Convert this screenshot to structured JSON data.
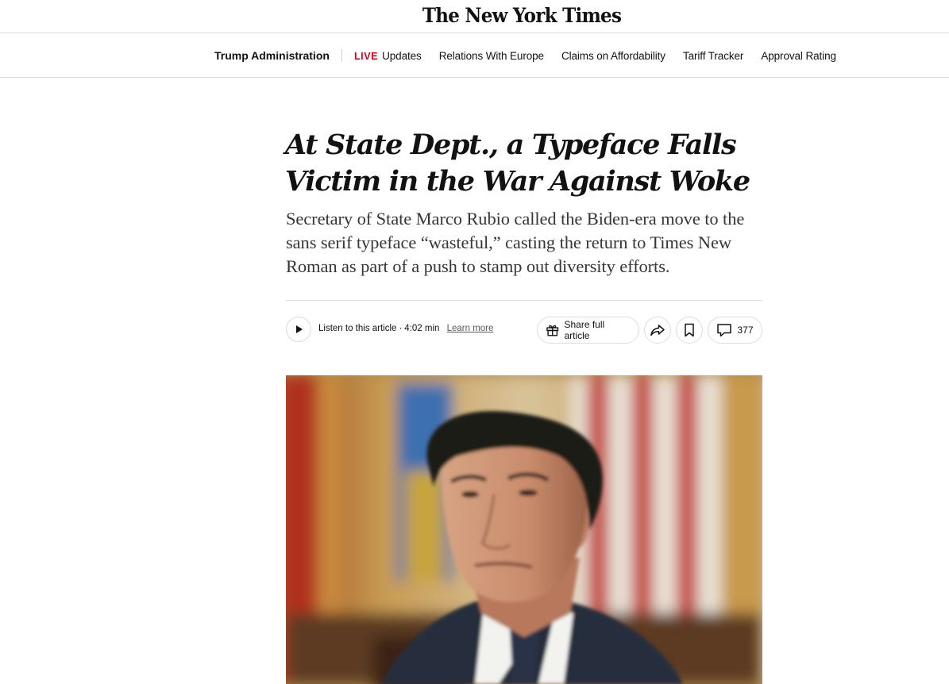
{
  "masthead": {
    "logo_text": "The New York Times"
  },
  "subnav": {
    "section_title": "Trump Administration",
    "live_tag": "LIVE",
    "links": [
      "Updates",
      "Relations With Europe",
      "Claims on Affordability",
      "Tariff Tracker",
      "Approval Rating"
    ],
    "live_color": "#d0021b"
  },
  "article": {
    "headline": "At State Dept., a Typeface Falls Victim in the War Against Woke",
    "summary": "Secretary of State Marco Rubio called the Biden-era move to the sans serif typeface “wasteful,” casting the return to Times New Roman as part of a push to stamp out diversity efforts."
  },
  "tools": {
    "listen_label": "Listen to this article",
    "separator": "·",
    "duration": "4:02 min",
    "learn_more": "Learn more",
    "share_full": "Share full article",
    "comment_count": "377",
    "icons": [
      "play-icon",
      "gift-icon",
      "share-arrow-icon",
      "bookmark-icon",
      "comment-icon"
    ]
  },
  "lead_image": {
    "subject": "man in dark suit in front of flags"
  }
}
